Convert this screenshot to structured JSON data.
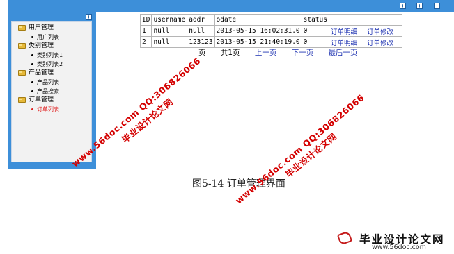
{
  "topbar": {
    "icons": [
      "+",
      "+",
      "+"
    ]
  },
  "sidebar": {
    "collapse_icon": "+",
    "groups": [
      {
        "label": "用户管理",
        "items": [
          {
            "label": "用户列表",
            "active": false
          }
        ]
      },
      {
        "label": "类别管理",
        "items": [
          {
            "label": "类别列表1",
            "active": false
          },
          {
            "label": "类别列表2",
            "active": false
          }
        ]
      },
      {
        "label": "产品管理",
        "items": [
          {
            "label": "产品列表",
            "active": false
          },
          {
            "label": "产品搜索",
            "active": false
          }
        ]
      },
      {
        "label": "订单管理",
        "items": [
          {
            "label": "订单列表",
            "active": true
          }
        ]
      }
    ]
  },
  "table": {
    "headers": [
      "ID",
      "username",
      "addr",
      "odate",
      "status"
    ],
    "rows": [
      {
        "id": "1",
        "username": "null",
        "addr": "null",
        "odate": "2013-05-15 16:02:31.0",
        "status": "0",
        "detail": "订单明细",
        "edit": "订单修改"
      },
      {
        "id": "2",
        "username": "null",
        "addr": "123123",
        "odate": "2013-05-15 21:40:19.0",
        "status": "0",
        "detail": "订单明细",
        "edit": "订单修改"
      }
    ]
  },
  "pager": {
    "current": "页",
    "total": "共1页",
    "prev": "上一页",
    "next": "下一页",
    "last": "最后一页"
  },
  "caption": "图5-14 订单管理界面",
  "watermarks": [
    "www.56doc.com QQ:306826066",
    "毕业设计论文网",
    "www.56doc.com QQ:306826066",
    "毕业设计论文网"
  ],
  "logo": {
    "title": "毕业设计论文网",
    "url": "www.56doc.com"
  },
  "colors": {
    "frame_blue": "#3d8fd9",
    "link_blue": "#1a2fb0",
    "active_red": "#e02020",
    "watermark_red": "#d40000"
  }
}
